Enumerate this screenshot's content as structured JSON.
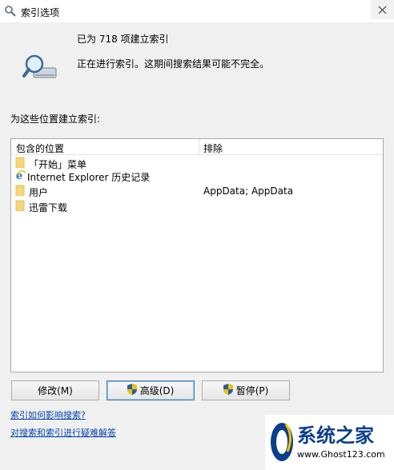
{
  "window": {
    "title": "索引选项",
    "title_icon": "indexing-options-icon"
  },
  "status": {
    "count_text": "已为 718 项建立索引",
    "message": "正在进行索引。这期间搜索结果可能不完全。",
    "icon": "magnifier-drive-icon"
  },
  "locations": {
    "section_label": "为这些位置建立索引:",
    "columns": {
      "included": "包含的位置",
      "excluded": "排除"
    },
    "rows": [
      {
        "location": "「开始」菜单",
        "exclude": "",
        "icon": "folder-icon"
      },
      {
        "location": "Internet Explorer 历史记录",
        "exclude": "",
        "icon": "ie-icon"
      },
      {
        "location": "用户",
        "exclude": "AppData; AppData",
        "icon": "folder-icon"
      },
      {
        "location": "迅雷下载",
        "exclude": "",
        "icon": "folder-icon"
      }
    ]
  },
  "buttons": {
    "modify": "修改(M)",
    "advanced": "高级(D)",
    "pause": "暂停(P)"
  },
  "links": {
    "how_affects": "索引如何影响搜索?",
    "troubleshoot": "对搜索和索引进行疑难解答"
  },
  "watermark": {
    "title": "系统之家",
    "url": "www.Ghost123.com"
  },
  "colors": {
    "link": "#0645ad",
    "folder": "#f5d67a",
    "accent": "#3c7fb1"
  }
}
